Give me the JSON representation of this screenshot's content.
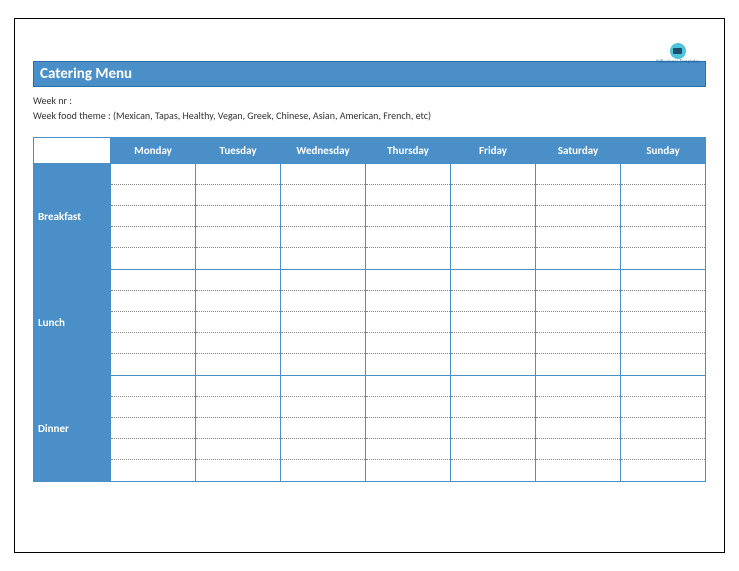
{
  "branding": {
    "logo_text": "AllBusiness\nTemplates"
  },
  "header": {
    "title": "Catering Menu"
  },
  "meta": {
    "week_nr_label": "Week nr :",
    "week_nr_value": "",
    "theme_label": "Week food theme :",
    "theme_hint": "(Mexican, Tapas, Healthy, Vegan, Greek, Chinese, Asian, American, French, etc)"
  },
  "table": {
    "days": [
      "Monday",
      "Tuesday",
      "Wednesday",
      "Thursday",
      "Friday",
      "Saturday",
      "Sunday"
    ],
    "meals": [
      "Breakfast",
      "Lunch",
      "Dinner"
    ],
    "subrows_per_meal": 5
  }
}
